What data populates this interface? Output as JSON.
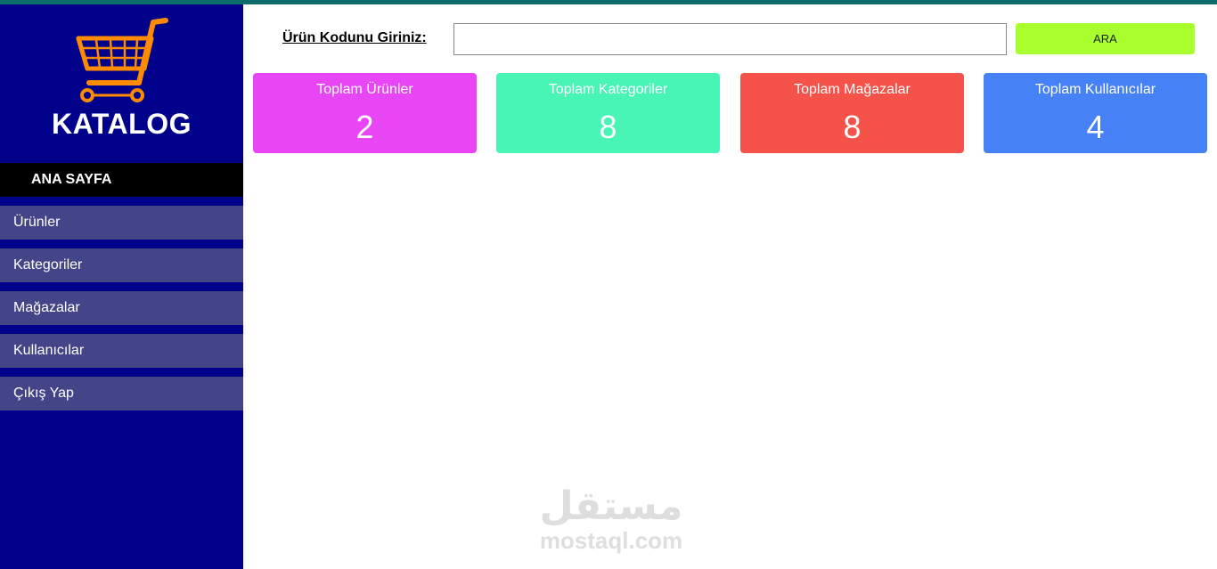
{
  "app": {
    "title": "KATALOG"
  },
  "sidebar": {
    "home_label": "ANA SAYFA",
    "items": [
      {
        "label": "Ürünler"
      },
      {
        "label": "Kategoriler"
      },
      {
        "label": "Mağazalar"
      },
      {
        "label": "Kullanıcılar"
      },
      {
        "label": "Çıkış Yap"
      }
    ]
  },
  "search": {
    "label": "Ürün Kodunu Giriniz:",
    "value": "",
    "button_label": "ARA"
  },
  "stats": [
    {
      "label": "Toplam Ürünler",
      "value": "2",
      "color": "#e846f5"
    },
    {
      "label": "Toplam Kategoriler",
      "value": "8",
      "color": "#48f5b4"
    },
    {
      "label": "Toplam Mağazalar",
      "value": "8",
      "color": "#f5524a"
    },
    {
      "label": "Toplam Kullanıcılar",
      "value": "4",
      "color": "#4682f5"
    }
  ],
  "watermark": {
    "arabic": "مستقل",
    "latin": "mostaql.com"
  },
  "colors": {
    "sidebar_bg": "#00008b",
    "nav_item_bg": "#444488",
    "button_bg": "#a9ff2e",
    "topbar": "#0b6b6b",
    "cart_icon": "#ff8c00"
  },
  "icons": {
    "logo": "shopping-cart-icon"
  }
}
